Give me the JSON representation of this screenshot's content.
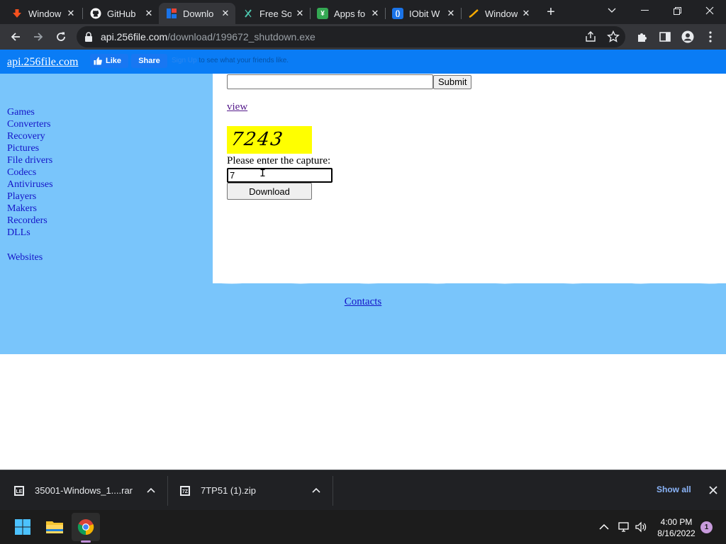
{
  "browser": {
    "tabs": [
      {
        "title": "Window",
        "favicon": "download-arrow-icon",
        "color": "#f4511e"
      },
      {
        "title": "GitHub",
        "favicon": "github-icon",
        "color": "#ffffff"
      },
      {
        "title": "Downlo",
        "favicon": "downloads-site-icon",
        "color": "#1a73e8"
      },
      {
        "title": "Free So",
        "favicon": "freesoft-icon",
        "color": "#4ec9b0"
      },
      {
        "title": "Apps fo",
        "favicon": "apps-icon",
        "color": "#34a853"
      },
      {
        "title": "IObit W",
        "favicon": "iobit-icon",
        "color": "#1a73e8"
      },
      {
        "title": "Window",
        "favicon": "window-brush-icon",
        "color": "#f9ab00"
      }
    ],
    "address": {
      "host": "api.256file.com",
      "path": "/download/199672_shutdown.exe"
    }
  },
  "page": {
    "site_link": "api.256file.com",
    "fb": {
      "like": "Like",
      "share": "Share",
      "sign_up": "Sign Up",
      "social_text": " to see what your friends like."
    },
    "nav": [
      "Games",
      "Converters",
      "Recovery",
      "Pictures",
      "File drivers",
      "Codecs",
      "Antiviruses",
      "Players",
      "Makers",
      "Recorders",
      "DLLs"
    ],
    "nav_extra": "Websites",
    "submit_label": "Submit",
    "view_link": "view",
    "captcha_text": "7243",
    "capture_label": "Please enter the capture:",
    "capture_value": "7",
    "download_label": "Download",
    "contacts": "Contacts"
  },
  "shelf": {
    "items": [
      {
        "name": "35001-Windows_1....rar",
        "icon": "rar-file-icon"
      },
      {
        "name": "7TP51 (1).zip",
        "icon": "zip-file-icon"
      }
    ],
    "show_all": "Show all"
  },
  "taskbar": {
    "time": "4:00 PM",
    "date": "8/16/2022",
    "notifications": "1"
  },
  "colors": {
    "site_topbar": "#0a7cf5",
    "site_sidebar": "#79c5fb",
    "captcha_bg": "#ffff00"
  }
}
